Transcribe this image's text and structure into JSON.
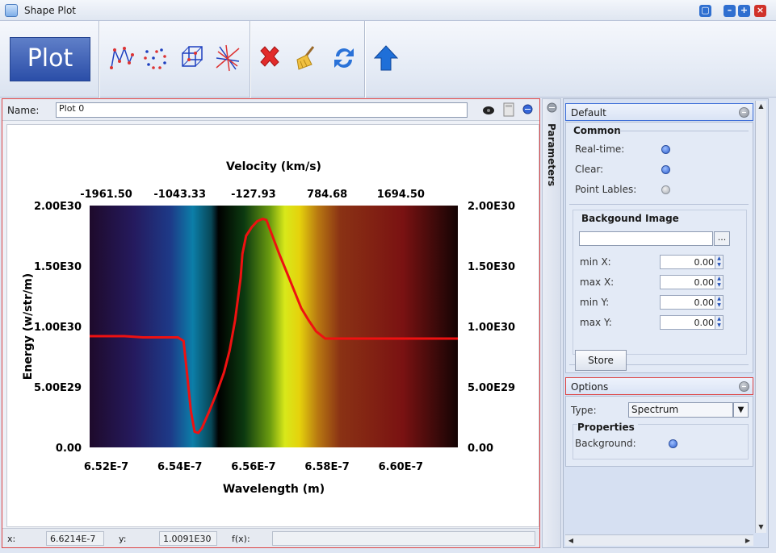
{
  "window": {
    "title": "Shape Plot"
  },
  "toolbar": {
    "plot_label": "Plot"
  },
  "plot_panel": {
    "name_label": "Name:",
    "name_value": "Plot 0"
  },
  "status": {
    "x_label": "x:",
    "x_value": "6.6214E-7",
    "y_label": "y:",
    "y_value": "1.0091E30",
    "fx_label": "f(x):",
    "fx_value": ""
  },
  "side": {
    "parameters_label": "Parameters"
  },
  "right": {
    "default_title": "Default",
    "common_title": "Common",
    "realtime_label": "Real-time:",
    "clear_label": "Clear:",
    "point_labels_label": "Point Lables:",
    "bg_image_title": "Backgound Image",
    "browse_label": "...",
    "minx_label": "min X:",
    "minx_value": "0.00",
    "maxx_label": "max X:",
    "maxx_value": "0.00",
    "miny_label": "min Y:",
    "miny_value": "0.00",
    "maxy_label": "max Y:",
    "maxy_value": "0.00",
    "store_label": "Store",
    "options_title": "Options",
    "type_label": "Type:",
    "type_value": "Spectrum",
    "properties_title": "Properties",
    "background_label": "Background:"
  },
  "chart_data": {
    "type": "line",
    "top_axis_label": "Velocity (km/s)",
    "top_ticks": [
      "-1961.50",
      "-1043.33",
      "-127.93",
      "784.68",
      "1694.50"
    ],
    "xlabel": "Wavelength (m)",
    "x_ticks": [
      "6.52E-7",
      "6.54E-7",
      "6.56E-7",
      "6.58E-7",
      "6.60E-7"
    ],
    "x_tick_values": [
      6.52e-07,
      6.54e-07,
      6.56e-07,
      6.58e-07,
      6.6e-07
    ],
    "ylabel": "Energy (w/str/m)",
    "y_ticks": [
      "0.00",
      "5.00E29",
      "1.00E30",
      "1.50E30",
      "2.00E30"
    ],
    "xlim": [
      6.5155e-07,
      6.6155e-07
    ],
    "ylim": [
      0,
      2e+30
    ],
    "line_color": "#ee1111",
    "series": [
      {
        "x": [
          6.5155e-07,
          6.525e-07,
          6.53e-07,
          6.535e-07,
          6.5395e-07,
          6.541e-07,
          6.542e-07,
          6.543e-07,
          6.544e-07,
          6.545e-07,
          6.546e-07,
          6.547e-07,
          6.548e-07,
          6.55e-07,
          6.552e-07,
          6.5535e-07,
          6.555e-07,
          6.5565e-07,
          6.557e-07,
          6.558e-07,
          6.5595e-07,
          6.561e-07,
          6.5625e-07,
          6.5635e-07,
          6.565e-07,
          6.567e-07,
          6.569e-07,
          6.571e-07,
          6.573e-07,
          6.575e-07,
          6.577e-07,
          6.5795e-07,
          6.585e-07,
          6.595e-07,
          6.6155e-07
        ],
        "y": [
          9.2e+29,
          9.2e+29,
          9.1e+29,
          9.1e+29,
          9.1e+29,
          8.8e+29,
          6e+29,
          3e+29,
          1.3e+29,
          1.2e+29,
          1.6e+29,
          2.3e+29,
          3e+29,
          4.5e+29,
          6.2e+29,
          8e+29,
          1.05e+30,
          1.4e+30,
          1.6e+30,
          1.75e+30,
          1.82e+30,
          1.87e+30,
          1.89e+30,
          1.88e+30,
          1.76e+30,
          1.6e+30,
          1.45e+30,
          1.3e+30,
          1.15e+30,
          1.05e+30,
          9.6e+29,
          9e+29,
          9e+29,
          9e+29,
          9e+29
        ]
      }
    ]
  }
}
